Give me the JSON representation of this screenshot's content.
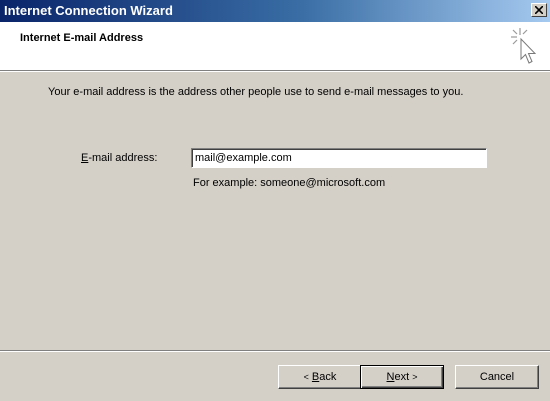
{
  "window": {
    "title": "Internet Connection Wizard"
  },
  "header": {
    "title": "Internet E-mail Address"
  },
  "content": {
    "intro": "Your e-mail address is the address other people use to send e-mail messages to you.",
    "email_label_accel": "E",
    "email_label_rest": "-mail address:",
    "email_value": "mail@example.com",
    "example": "For example: someone@microsoft.com"
  },
  "buttons": {
    "back_arrow": "<",
    "back_accel": "B",
    "back_rest": "ack",
    "next_accel": "N",
    "next_rest": "ext",
    "next_arrow": ">",
    "cancel": "Cancel"
  },
  "icons": {
    "close": "close-icon",
    "wizard": "cursor-sparkle-icon"
  },
  "colors": {
    "titlebar_start": "#0a246a",
    "titlebar_end": "#a6caf0",
    "face": "#d4d0c8",
    "header_bg": "#ffffff"
  }
}
